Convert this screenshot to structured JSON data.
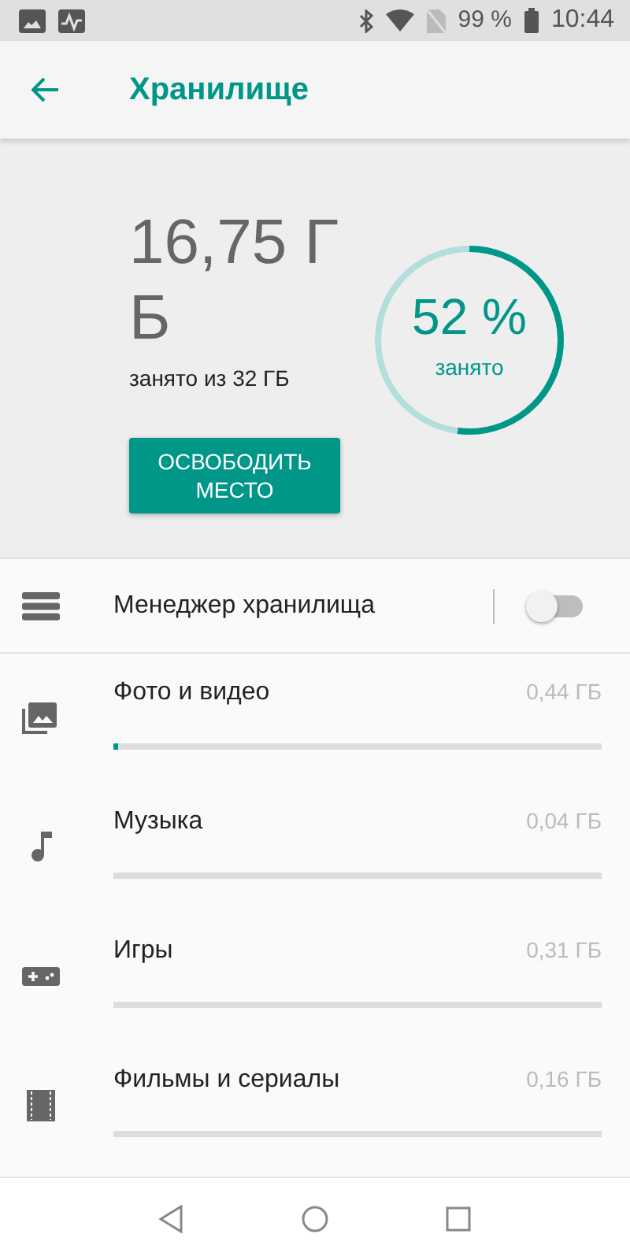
{
  "status_bar": {
    "battery": "99 %",
    "time": "10:44"
  },
  "app_bar": {
    "title": "Хранилище"
  },
  "summary": {
    "used": "16,75 ГБ",
    "caption": "занято из 32 ГБ",
    "button": "ОСВОБОДИТЬ МЕСТО",
    "percent": "52 %",
    "percent_label": "занято",
    "level": 0.52
  },
  "manager": {
    "label": "Менеджер хранилища",
    "on": false
  },
  "categories": [
    {
      "kind": "photo",
      "label": "Фото и видео",
      "size": "0,44 ГБ",
      "level": 0.01
    },
    {
      "kind": "music",
      "label": "Музыка",
      "size": "0,04 ГБ",
      "level": 0
    },
    {
      "kind": "games",
      "label": "Игры",
      "size": "0,31 ГБ",
      "level": 0
    },
    {
      "kind": "movies",
      "label": "Фильмы и сериалы",
      "size": "0,16 ГБ",
      "level": 0
    }
  ]
}
